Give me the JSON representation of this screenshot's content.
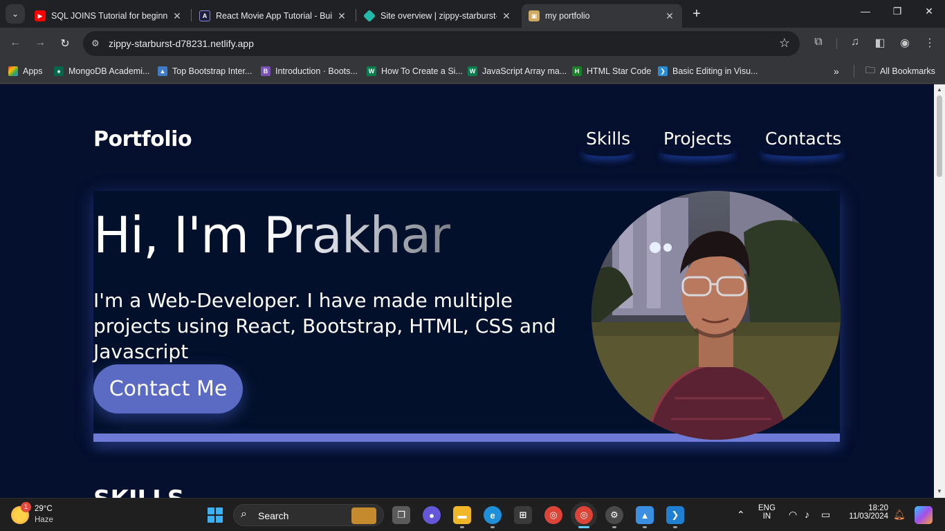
{
  "browser": {
    "tabs": [
      {
        "title": "SQL JOINS Tutorial for beginners",
        "icon": "youtube-icon",
        "color": "#ff0000"
      },
      {
        "title": "React Movie App Tutorial - Build",
        "icon": "react-icon",
        "color": "#1e1e3f"
      },
      {
        "title": "Site overview | zippy-starburst-d",
        "icon": "netlify-icon",
        "color": "#24b8a8"
      },
      {
        "title": "my portfolio",
        "icon": "portfolio-icon",
        "color": "#cfa95f"
      }
    ],
    "address": "zippy-starburst-d78231.netlify.app",
    "bookmarks": [
      "Apps",
      "MongoDB Academi...",
      "Top Bootstrap Inter...",
      "Introduction · Boots...",
      "How To Create a Si...",
      "JavaScript Array ma...",
      "HTML Star Code",
      "Basic Editing in Visu...",
      "All Bookmarks"
    ]
  },
  "portfolio": {
    "brand": "Portfolio",
    "nav": [
      "Skills",
      "Projects",
      "Contacts"
    ],
    "hero": {
      "greeting": "Hi, I'm ",
      "name": "Prakhar",
      "intro": "I'm a Web-Developer. I have made multiple projects using React, Bootstrap, HTML, CSS and Javascript",
      "cta": "Contact Me"
    },
    "next_section": "SKILLS"
  },
  "taskbar": {
    "weather_temp": "29°C",
    "weather_desc": "Haze",
    "weather_badge": "1",
    "search_label": "Search",
    "language_1": "ENG",
    "language_2": "IN",
    "time": "18:20",
    "date": "11/03/2024"
  },
  "colors": {
    "page_bg": "#050f2e",
    "accent": "#5b6bc4",
    "chrome_bg": "#35363a"
  }
}
